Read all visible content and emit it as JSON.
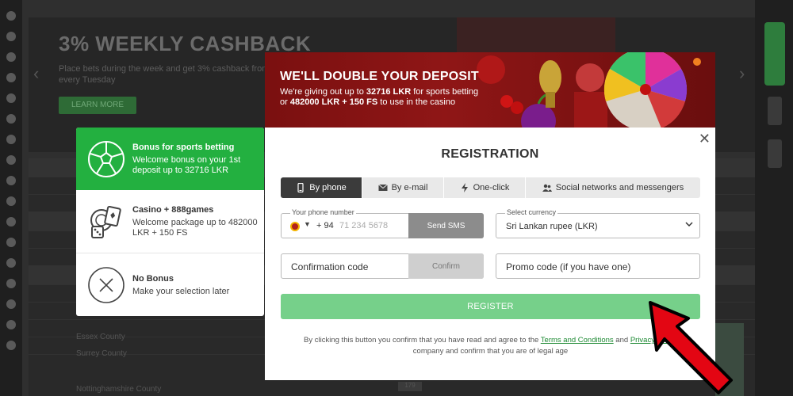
{
  "background": {
    "banner_title": "3% WEEKLY CASHBACK",
    "banner_subtitle": "Place bets during the week and get 3% cashback from every Tuesday",
    "banner_button": "LEARN MORE",
    "teams": [
      "Essex County",
      "Surrey County",
      "Nottinghamshire County"
    ],
    "score": "179"
  },
  "bonus_options": [
    {
      "title": "Bonus for sports betting",
      "description": "Welcome bonus on your 1st deposit up to 32716 LKR",
      "icon": "soccer-ball-icon",
      "active": true
    },
    {
      "title": "Casino + 888games",
      "description": "Welcome package up to 482000 LKR + 150 FS",
      "icon": "casino-chips-icon",
      "active": false
    },
    {
      "title": "No Bonus",
      "description": "Make your selection later",
      "icon": "no-bonus-icon",
      "active": false
    }
  ],
  "promo": {
    "heading": "WE'LL DOUBLE YOUR DEPOSIT",
    "line1_pre": "We're giving out up to ",
    "line1_bold": "32716 LKR",
    "line1_post": " for sports betting",
    "line2_pre": "or ",
    "line2_bold": "482000 LKR + 150 FS",
    "line2_post": " to use in the casino"
  },
  "registration": {
    "title": "REGISTRATION",
    "close": "✕",
    "tabs": [
      {
        "label": "By phone",
        "icon": "phone-icon"
      },
      {
        "label": "By e-mail",
        "icon": "envelope-icon"
      },
      {
        "label": "One-click",
        "icon": "lightning-icon"
      },
      {
        "label": "Social networks and messengers",
        "icon": "users-icon"
      }
    ],
    "phone_label": "Your phone number",
    "country_code": "+ 94",
    "phone_placeholder": "71 234 5678",
    "send_sms": "Send SMS",
    "currency_label": "Select currency",
    "currency_value": "Sri Lankan rupee (LKR)",
    "confirmation_placeholder": "Confirmation code",
    "confirm_button": "Confirm",
    "promo_placeholder": "Promo code (if you have one)",
    "register_button": "REGISTER",
    "legal_pre": "By clicking this button you confirm that you have read and agree to the ",
    "legal_terms": "Terms and Conditions",
    "legal_mid": " and ",
    "legal_privacy": "Privacy Policy",
    "legal_post": " company and confirm that you are of legal age"
  },
  "colors": {
    "accent_green": "#23b040",
    "register_green": "#76d08a",
    "promo_red": "#8f1616",
    "pointer_red": "#e30613"
  }
}
